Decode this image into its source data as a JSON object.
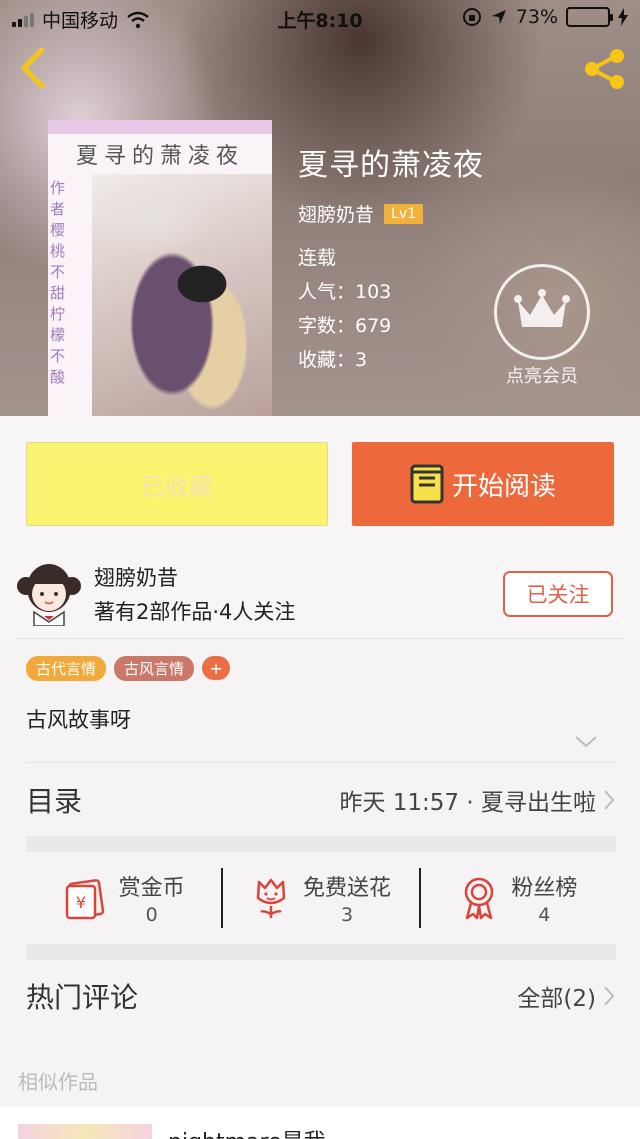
{
  "status_bar": {
    "carrier": "中国移动",
    "time": "上午8:10",
    "battery": "73%",
    "battery_level": 0.73
  },
  "book": {
    "title": "夏寻的萧凌夜",
    "author": "翅膀奶昔",
    "level": "Lv1",
    "status": "连载",
    "popularity": "人气：103",
    "word_count": "字数：679",
    "favorites": "收藏：3",
    "cover": {
      "title": "夏寻的萧凌夜",
      "side_text": "作者樱桃不甜柠檬不酸"
    }
  },
  "vip": {
    "label": "点亮会员"
  },
  "actions": {
    "favorited_label": "已收藏",
    "read_label": "开始阅读"
  },
  "author_card": {
    "name": "翅膀奶昔",
    "stats": "著有2部作品·4人关注",
    "follow_label": "已关注"
  },
  "tags": [
    {
      "label": "古代言情",
      "color": "#f2a93b"
    },
    {
      "label": "古风言情",
      "color": "#c9786a"
    }
  ],
  "tag_add": "+",
  "intro": "古风故事呀",
  "toc": {
    "label": "目录",
    "latest": "昨天 11:57 · 夏寻出生啦"
  },
  "stats": [
    {
      "label": "赏金币",
      "value": "0",
      "icon": "red-envelope-icon"
    },
    {
      "label": "免费送花",
      "value": "3",
      "icon": "flower-icon"
    },
    {
      "label": "粉丝榜",
      "value": "4",
      "icon": "medal-icon"
    }
  ],
  "comments": {
    "label": "热门评论",
    "all_label": "全部(2)"
  },
  "similar": {
    "label": "相似作品",
    "first_title": "nightmare是我"
  },
  "colors": {
    "accent_orange": "#ed693c",
    "favorite_yellow": "#fbf46e",
    "follow_red": "#e06049",
    "icon_red": "#d9453a"
  }
}
